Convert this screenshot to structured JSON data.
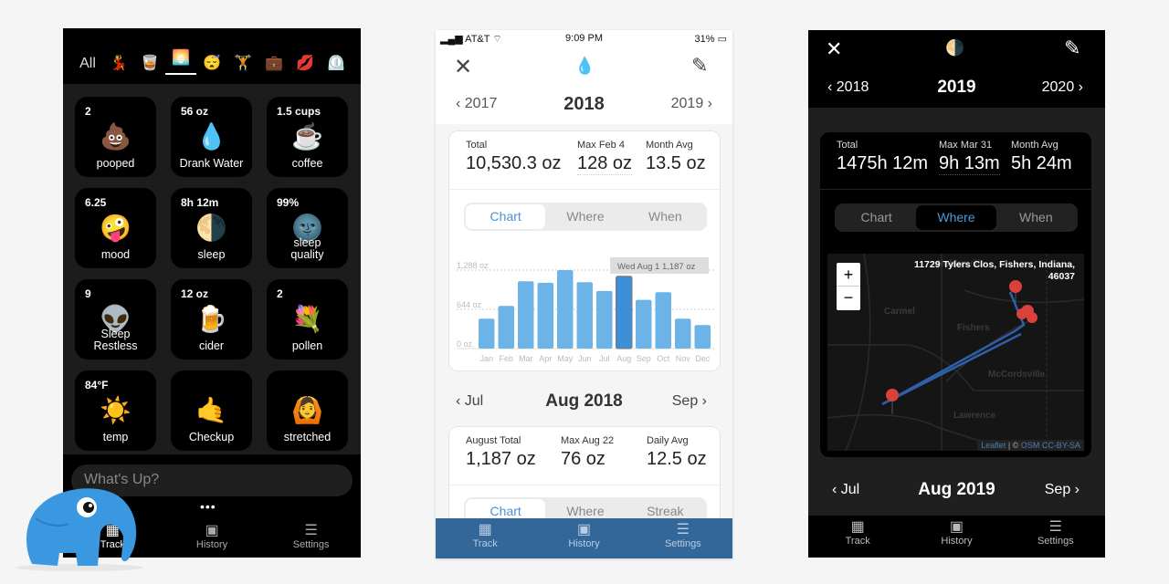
{
  "panel1": {
    "categories": [
      {
        "label": "All",
        "selected": false
      },
      {
        "label": "💃"
      },
      {
        "label": "🥃"
      },
      {
        "label": "🌅",
        "selected": true
      },
      {
        "label": "😴"
      },
      {
        "label": "🏋️"
      },
      {
        "label": "💼"
      },
      {
        "label": "💋"
      },
      {
        "label": "⏲️"
      }
    ],
    "tiles": [
      {
        "value": "2",
        "emoji": "💩",
        "label": "pooped"
      },
      {
        "value": "56 oz",
        "emoji": "💧",
        "label": "Drank Water"
      },
      {
        "value": "1.5 cups",
        "emoji": "☕",
        "label": "coffee"
      },
      {
        "value": "6.25",
        "emoji": "🤪",
        "label": "mood"
      },
      {
        "value": "8h 12m",
        "emoji": "🌗",
        "label": "sleep"
      },
      {
        "value": "99%",
        "emoji": "🌚",
        "label": "sleep quality"
      },
      {
        "value": "9",
        "emoji": "👽",
        "label": "Sleep Restless"
      },
      {
        "value": "12 oz",
        "emoji": "🍺",
        "label": "cider"
      },
      {
        "value": "2",
        "emoji": "💐",
        "label": "pollen"
      },
      {
        "value": "84°F",
        "emoji": "☀️",
        "label": "temp"
      },
      {
        "value": "",
        "emoji": "🤙",
        "label": "Checkup"
      },
      {
        "value": "",
        "emoji": "🙆",
        "label": "stretched"
      }
    ],
    "input_placeholder": "What's Up?",
    "more": "•••",
    "tabs": [
      {
        "label": "Track",
        "icon": "grid-icon"
      },
      {
        "label": "History",
        "icon": "calendar-icon"
      },
      {
        "label": "Settings",
        "icon": "menu-icon"
      }
    ]
  },
  "panel2": {
    "status": {
      "carrier": "AT&T",
      "time": "9:09 PM",
      "battery": "31%"
    },
    "icon": "💧",
    "year_nav": {
      "prev": "2017",
      "current": "2018",
      "next": "2019"
    },
    "stats": [
      {
        "label": "Total",
        "value": "10,530.3 oz"
      },
      {
        "label": "Max Feb 4",
        "value": "128 oz"
      },
      {
        "label": "Month Avg",
        "value": "13.5 oz"
      }
    ],
    "segments": [
      "Chart",
      "Where",
      "When"
    ],
    "tooltip": "Wed Aug 1  1,187 oz",
    "month_nav": {
      "prev": "Jul",
      "current": "Aug 2018",
      "next": "Sep"
    },
    "month_stats": [
      {
        "label": "August Total",
        "value": "1,187 oz"
      },
      {
        "label": "Max Aug 22",
        "value": "76 oz"
      },
      {
        "label": "Daily Avg",
        "value": "12.5 oz"
      }
    ],
    "month_segments": [
      "Chart",
      "Where",
      "Streak"
    ],
    "tabs": [
      "Track",
      "History",
      "Settings"
    ],
    "accent": "#4a90d9",
    "tabbar_color": "#336699"
  },
  "chart_data": {
    "type": "bar",
    "categories": [
      "Jan",
      "Feb",
      "Mar",
      "Apr",
      "May",
      "Jun",
      "Jul",
      "Aug",
      "Sep",
      "Oct",
      "Nov",
      "Dec"
    ],
    "values": [
      490,
      700,
      1105,
      1080,
      1288,
      1090,
      945,
      1187,
      800,
      925,
      490,
      385
    ],
    "yticks": [
      "0 oz",
      "644 oz",
      "1,288 oz"
    ],
    "ylim": [
      0,
      1288
    ],
    "highlight": "Aug",
    "color": "#6cb4e8",
    "highlight_color": "#3d8fd8"
  },
  "panel3": {
    "icon": "🌗",
    "year_nav": {
      "prev": "2018",
      "current": "2019",
      "next": "2020"
    },
    "stats": [
      {
        "label": "Total",
        "value": "1475h 12m"
      },
      {
        "label": "Max Mar 31",
        "value": "9h 13m"
      },
      {
        "label": "Month Avg",
        "value": "5h 24m"
      }
    ],
    "segments": [
      "Chart",
      "Where",
      "When"
    ],
    "map": {
      "address": "11729 Tylers Clos, Fishers, Indiana, 46037",
      "places": [
        "Noblesville",
        "Carmel",
        "Fishers",
        "McCordsville",
        "Lawrence"
      ],
      "zoom_in": "+",
      "zoom_out": "−",
      "attribution_leaflet": "Leaflet",
      "attribution_sep": "| ©",
      "attribution_osm": "OSM CC-BY-SA"
    },
    "month_nav": {
      "prev": "Jul",
      "current": "Aug 2019",
      "next": "Sep"
    },
    "tabs": [
      "Track",
      "History",
      "Settings"
    ]
  }
}
